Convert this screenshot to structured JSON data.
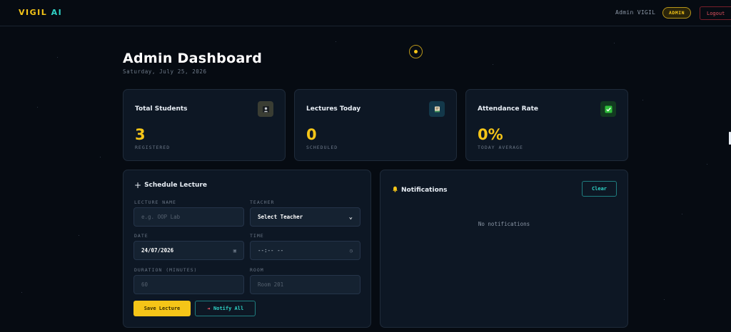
{
  "app": {
    "logo_main": "VIGIL",
    "logo_accent": " AI",
    "admin_name": "Admin VIGIL",
    "admin_badge": "ADMIN",
    "logout_label": "Logout"
  },
  "colors": {
    "accent": "#f5c518",
    "teal": "#2fd3c7",
    "danger": "#e0515f",
    "background": "#060b12",
    "card": "#0d1724"
  },
  "page": {
    "title": "Admin Dashboard",
    "date": "Saturday, July 25, 2026"
  },
  "stats": [
    {
      "title": "Total Students",
      "value": "3",
      "sub": "REGISTERED",
      "icon": "student-icon"
    },
    {
      "title": "Lectures Today",
      "value": "0",
      "sub": "SCHEDULED",
      "icon": "book-icon"
    },
    {
      "title": "Attendance Rate",
      "value": "0%",
      "sub": "TODAY AVERAGE",
      "icon": "check-icon"
    }
  ],
  "schedule": {
    "title": "Schedule Lecture",
    "lecture_name_label": "LECTURE NAME",
    "lecture_name_placeholder": "e.g. OOP Lab",
    "teacher_label": "TEACHER",
    "teacher_value": "Select Teacher",
    "date_label": "DATE",
    "date_value": "24/07/2026",
    "time_label": "TIME",
    "time_value": "--:-- --",
    "duration_label": "DURATION (MINUTES)",
    "duration_placeholder": "60",
    "room_label": "ROOM",
    "room_placeholder": "Room 201",
    "save_label": "Save Lecture",
    "notify_label": "Notify All"
  },
  "notifications": {
    "title": "Notifications",
    "clear_label": "Clear",
    "empty_text": "No notifications"
  }
}
